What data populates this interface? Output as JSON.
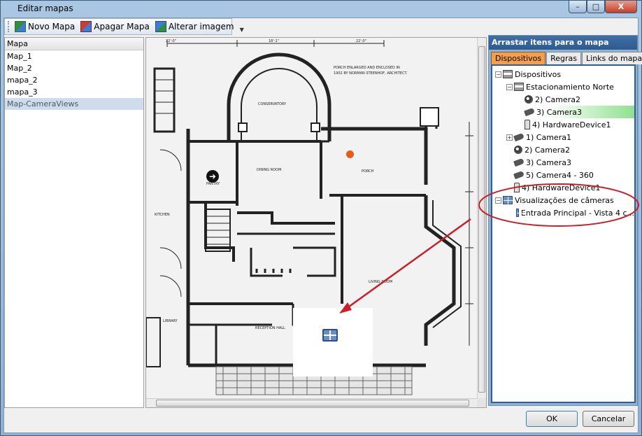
{
  "window": {
    "title": "Editar mapas",
    "minimize_glyph": "–",
    "maximize_glyph": "□",
    "close_glyph": "X"
  },
  "toolbar": {
    "novo_label": "Novo Mapa",
    "apagar_label": "Apagar Mapa",
    "alterar_label": "Alterar imagem"
  },
  "maps_panel": {
    "header": "Mapa",
    "items": [
      "Map_1",
      "Map_2",
      "mapa_2",
      "mapa_3",
      "Map-CameraViews"
    ],
    "selected": "Map-CameraViews"
  },
  "floorplan": {
    "texts": {
      "dim1": "22'-0\"",
      "dim2": "18'-1\"",
      "dim3": "22'-0\"",
      "note1": "PORCH ENLARGED AND ENCLOSED IN",
      "note2": "1902 BY NORMAN STEENHOF, ARCHITECT.",
      "conservatory": "CONSERVATORY",
      "pantry": "PANTRY",
      "dining": "DINING ROOM",
      "porch": "PORCH",
      "kitchen": "KITCHEN",
      "living": "LIVING ROOM",
      "library": "LIBRARY",
      "reception": "RECEPTION HALL"
    }
  },
  "devices_panel": {
    "header": "Arrastar itens para o mapa",
    "tabs": [
      "Dispositivos",
      "Regras",
      "Links do mapa"
    ],
    "active_tab": "Dispositivos",
    "tree": {
      "root": "Dispositivos",
      "group": "Estacionamiento Norte",
      "group_items": [
        "2) Camera2",
        "3) Camera3",
        "4) HardwareDevice1"
      ],
      "items": [
        "1) Camera1",
        "2) Camera2",
        "3) Camera3",
        "5) Camera4 - 360",
        "4) HardwareDevice1"
      ],
      "views_root": "Visualizações de câmeras",
      "views_items": [
        "Entrada Principal - Vista 4 c..."
      ]
    }
  },
  "buttons": {
    "ok": "OK",
    "cancel": "Cancelar"
  },
  "colors": {
    "title_bar": "#a9c7e2",
    "panel_header": "#2e5a8f",
    "active_tab": "#f4a04a",
    "selected_node": "#8fe08f",
    "annotation": "#c8202a",
    "hotspot": "#e85a1a"
  }
}
